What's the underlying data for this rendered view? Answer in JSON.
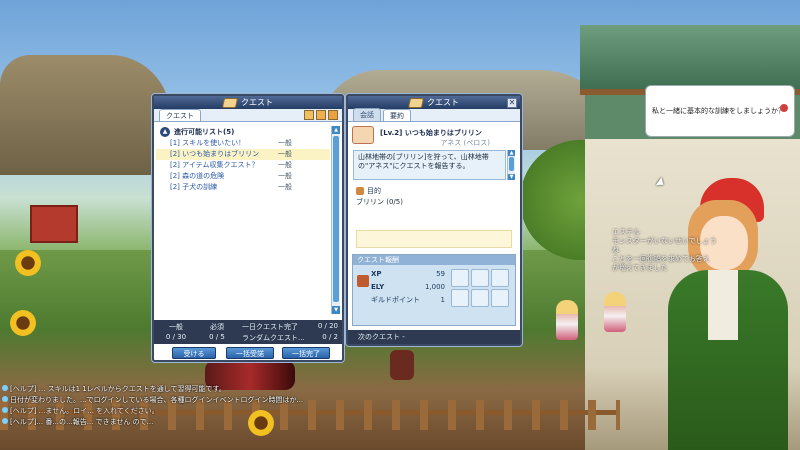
{
  "quest_window": {
    "title": "クエスト",
    "tab": "クエスト",
    "section_header": "進行可能リスト(5)",
    "quests": [
      {
        "name": "[1] スキルを使いたい！",
        "type": "一般"
      },
      {
        "name": "[2] いつも始まりはブリリン",
        "type": "一般"
      },
      {
        "name": "[2] アイテム収集クエスト？",
        "type": "一般"
      },
      {
        "name": "[2] 森の道の危険",
        "type": "一般"
      },
      {
        "name": "[2] 子犬の訓練",
        "type": "一般"
      }
    ],
    "stats": {
      "general_label": "一般",
      "general_value": "0 / 30",
      "required_label": "必須",
      "required_value": "0 / 5",
      "daily_label": "一日クエスト完了",
      "daily_value": "0 / 20",
      "random_label": "ランダムクエスト...",
      "random_value": "0 / 2"
    },
    "buttons": {
      "accept": "受ける",
      "accept_all": "一括受諾",
      "complete_all": "一括完了"
    }
  },
  "detail_window": {
    "title": "クエスト",
    "tabs": [
      "会話",
      "要約"
    ],
    "quest_title": "[Lv.2] いつも始まりはブリリン",
    "npc_name": "アネス (ペロス)",
    "description": "山林地帯の[ブリリン]を狩って、山林地帯の\"アネス\"にクエストを報告する。",
    "objective_label": "目的",
    "objective_item": "ブリリン (0/5)",
    "reward_header": "クエスト報酬",
    "rewards": [
      {
        "label": "XP",
        "value": "59"
      },
      {
        "label": "ELY",
        "value": "1,000"
      },
      {
        "label": "ギルドポイント",
        "value": "1"
      }
    ],
    "next_quest": "次のクエスト -"
  },
  "npc_dialogue": "私と一緒に基本的な訓練をしましょうか？",
  "npc_tooltip": [
    "エステル",
    "モンスターがいないせいでしょうね",
    "ことを一回復唱を求めてお答え",
    "が増えてきました"
  ],
  "chat_log": [
    "[ヘルプ] ... スキルは1 1レベルからクエストを通して習得可能です。",
    "日付が変わりました。...でログインしている場合、各種ログインイベントログイン時間はか...",
    "[ヘルプ] ...ません。ロイ... を入れてください。",
    "[ヘルプ]... 番...の...報告... できません ので..."
  ],
  "colors": {
    "accent": "#2a62a8",
    "title_bar": "#243c64",
    "selected_row": "#fbf3c4",
    "link_text": "#2a58a8"
  }
}
